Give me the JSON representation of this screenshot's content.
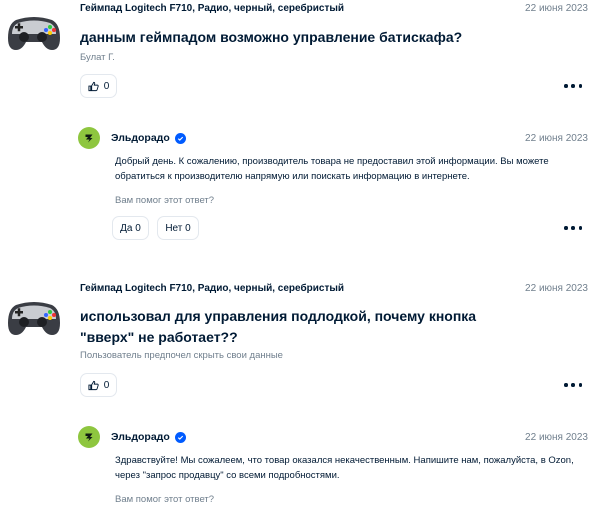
{
  "questions": [
    {
      "product": "Геймпад Logitech F710, Радио, черный, серебристый",
      "date": "22 июня 2023",
      "question": "данным геймпадом возможно управление батискафа?",
      "author": "Булат Г.",
      "likes": "0",
      "answer": {
        "seller": "Эльдорадо",
        "date": "22 июня 2023",
        "text": "Добрый день. К сожалению, производитель товара не предоставил этой информации. Вы можете обратиться к производителю напрямую или поискать информацию в интернете.",
        "helpful_prompt": "Вам помог этот ответ?",
        "yes_label": "Да 0",
        "no_label": "Нет 0"
      }
    },
    {
      "product": "Геймпад Logitech F710, Радио, черный, серебристый",
      "date": "22 июня 2023",
      "question": "использовал для управления подлодкой, почему кнопка \"вверх\" не работает??",
      "author": "Пользователь предпочел скрыть свои данные",
      "likes": "0",
      "answer": {
        "seller": "Эльдорадо",
        "date": "22 июня 2023",
        "text": "Здравствуйте! Мы сожалеем, что товар оказался некачественным. Напишите нам, пожалуйста, в Ozon, через \"запрос продавцу\" со всеми подробностями.",
        "helpful_prompt": "Вам помог этот ответ?"
      }
    }
  ],
  "icons": {
    "thumbnail": "gamepad-image",
    "like": "thumbs-up-icon",
    "more": "more-dots-icon",
    "seller_logo": "eldorado-logo",
    "verified": "verified-check-icon"
  },
  "colors": {
    "text": "#001a34",
    "muted": "#707f8d",
    "border": "#e3e8ee",
    "verified": "#005bff",
    "seller_logo": "#8ec63f"
  }
}
